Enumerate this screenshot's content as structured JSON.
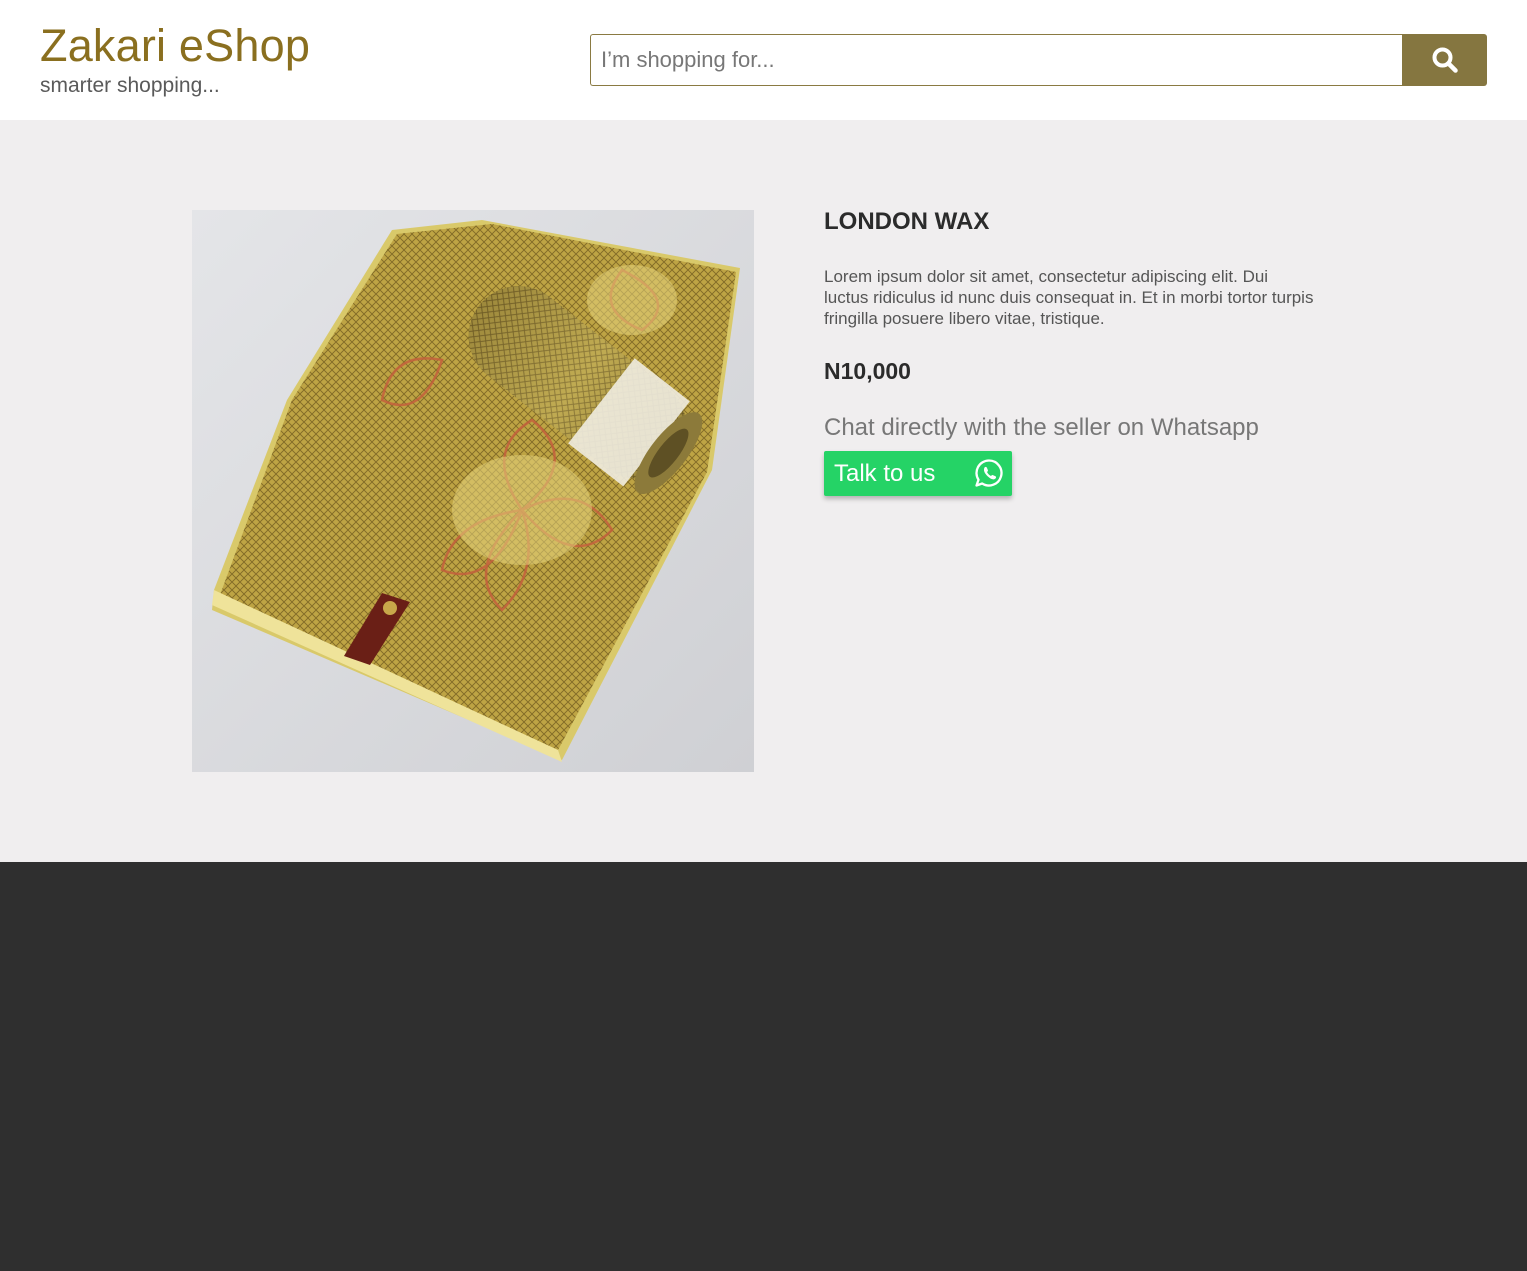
{
  "header": {
    "brand": "Zakari eShop",
    "tagline": "smarter shopping...",
    "search": {
      "placeholder": "I’m shopping for...",
      "value": ""
    }
  },
  "product": {
    "name": "LONDON WAX",
    "description": "Lorem ipsum dolor sit amet, consectetur adipiscing elit. Dui luctus ridiculus id nunc duis consequat in. Et in morbi tortor turpis fringilla posuere libero vitae, tristique.",
    "price": "N10,000",
    "chat_prompt": "Chat directly with the seller on Whatsapp",
    "cta_label": "Talk to us"
  },
  "icons": {
    "search": "search-icon",
    "whatsapp": "whatsapp-icon"
  },
  "colors": {
    "brand": "#8a6f1f",
    "search_button": "#857640",
    "whatsapp_green": "#25d366",
    "main_bg": "#f0eeef",
    "footer_bg": "#2f2f2f"
  }
}
